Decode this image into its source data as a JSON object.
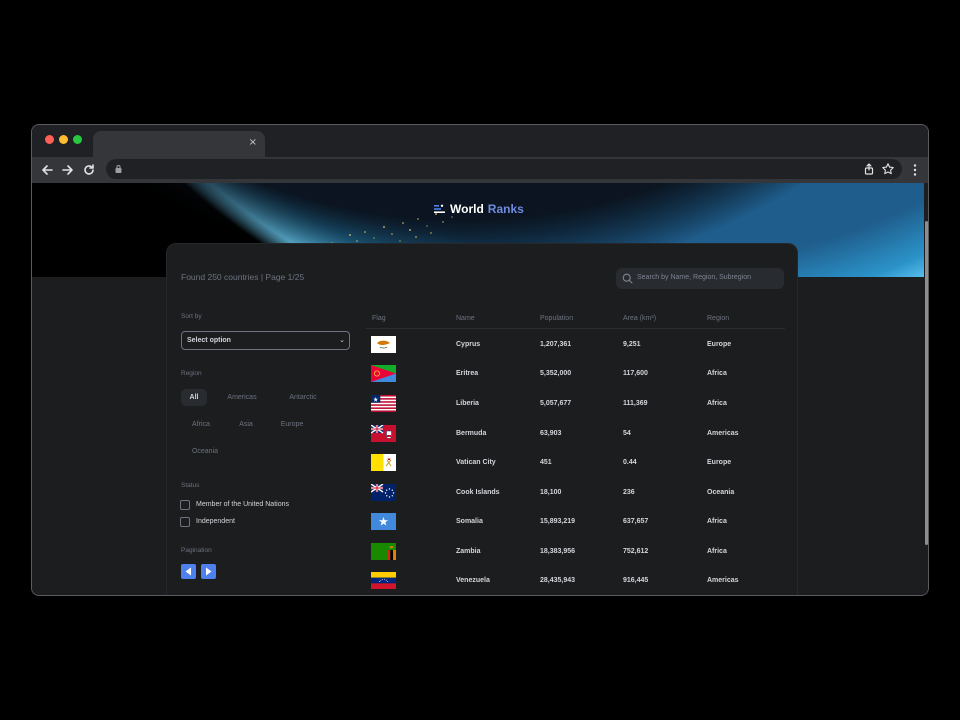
{
  "browser": {
    "tab_close": "×",
    "traffic_colors": [
      "#ff5f57",
      "#febc2e",
      "#28c840"
    ]
  },
  "app": {
    "logo_word1": "World",
    "logo_word2": "Ranks",
    "found_text": "Found 250 countries | Page 1/25",
    "search_placeholder": "Search by Name, Region, Subregion",
    "accent": "#4e80ee"
  },
  "filters": {
    "sort_label": "Sort by",
    "sort_value": "Select option",
    "region_label": "Region",
    "regions": [
      {
        "label": "All",
        "active": true
      },
      {
        "label": "Americas",
        "active": false
      },
      {
        "label": "Antarctic",
        "active": false
      },
      {
        "label": "Africa",
        "active": false
      },
      {
        "label": "Asia",
        "active": false
      },
      {
        "label": "Europe",
        "active": false
      },
      {
        "label": "Oceania",
        "active": false
      }
    ],
    "status_label": "Status",
    "status_options": [
      "Member of the United Nations",
      "Independent"
    ],
    "pagination_label": "Pagination"
  },
  "table": {
    "headers": [
      "Flag",
      "Name",
      "Population",
      "Area (km²)",
      "Region"
    ],
    "rows": [
      {
        "flag": "cyprus-flag",
        "name": "Cyprus",
        "population": "1,207,361",
        "area": "9,251",
        "region": "Europe"
      },
      {
        "flag": "eritrea-flag",
        "name": "Eritrea",
        "population": "5,352,000",
        "area": "117,600",
        "region": "Africa"
      },
      {
        "flag": "liberia-flag",
        "name": "Liberia",
        "population": "5,057,677",
        "area": "111,369",
        "region": "Africa"
      },
      {
        "flag": "bermuda-flag",
        "name": "Bermuda",
        "population": "63,903",
        "area": "54",
        "region": "Americas"
      },
      {
        "flag": "vatican-flag",
        "name": "Vatican City",
        "population": "451",
        "area": "0.44",
        "region": "Europe"
      },
      {
        "flag": "cook-islands-flag",
        "name": "Cook Islands",
        "population": "18,100",
        "area": "236",
        "region": "Oceania"
      },
      {
        "flag": "somalia-flag",
        "name": "Somalia",
        "population": "15,893,219",
        "area": "637,657",
        "region": "Africa"
      },
      {
        "flag": "zambia-flag",
        "name": "Zambia",
        "population": "18,383,956",
        "area": "752,612",
        "region": "Africa"
      },
      {
        "flag": "venezuela-flag",
        "name": "Venezuela",
        "population": "28,435,943",
        "area": "916,445",
        "region": "Americas"
      }
    ]
  }
}
